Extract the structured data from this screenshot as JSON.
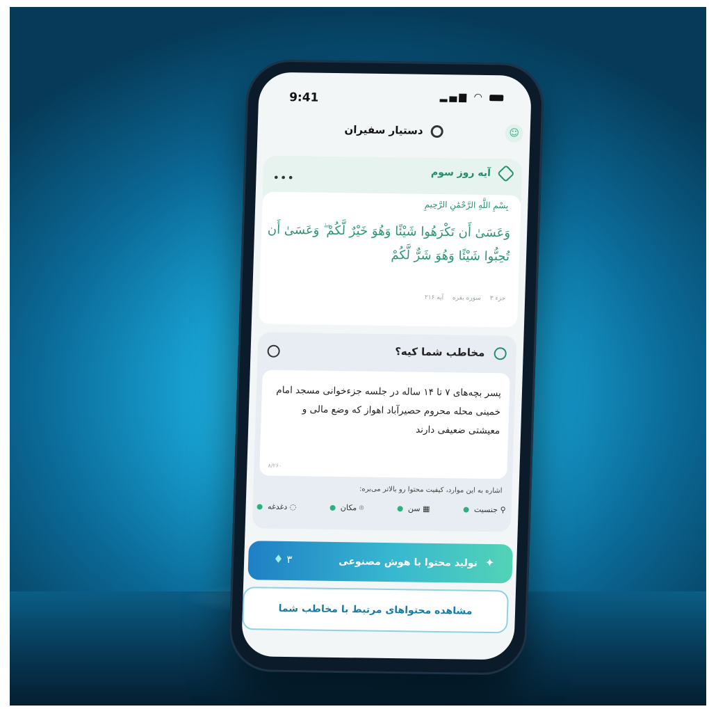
{
  "status_bar": {
    "time": "9:41"
  },
  "header": {
    "title": "دستیار سفیران",
    "logo_icon": "logo-icon",
    "profile_icon": "user-icon"
  },
  "verse_card": {
    "title": "آیه روز سوم",
    "bismillah": "بِسْمِ اللَّهِ الرَّحْمَٰنِ الرَّحِيمِ",
    "verse_text": "وَعَسَىٰ أَن تَكْرَهُوا شَيْئًا وَهُوَ خَيْرٌ لَّكُمْ ۖ وَعَسَىٰ أَن تُحِبُّوا شَيْئًا وَهُوَ شَرٌّ لَّكُمْ",
    "ref_juz": "جزء ۳",
    "ref_surah": "سوره بقره",
    "ref_ayah": "آیه ۲۱۶",
    "more_label": "•••"
  },
  "audience_card": {
    "title": "مخاطب شما کیه؟",
    "description": "پسر بچه‌های ۷ تا ۱۴ ساله در جلسه جزءخوانی مسجد امام خمینی محله محروم حصیرآباد اهواز که وضع مالی و معیشتی ضعیفی دارند",
    "char_count": "۸/۲۶۰",
    "hint": "اشاره به این موارد، کیفیت محتوا رو بالاتر می‌بره:",
    "chips": [
      {
        "label": "جنسیت",
        "icon": "person-icon"
      },
      {
        "label": "سن",
        "icon": "calendar-icon"
      },
      {
        "label": "مکان",
        "icon": "location-icon"
      },
      {
        "label": "دغدغه",
        "icon": "chat-icon"
      }
    ]
  },
  "actions": {
    "generate_label": "تولید محتوا با هوش مصنوعی",
    "generate_cost": "۳",
    "view_related_label": "مشاهده محتواهای مرتبط با مخاطب شما"
  },
  "colors": {
    "accent_green": "#238e6e",
    "button_gradient_start": "#1f7fc5",
    "button_gradient_end": "#52d3b6"
  }
}
